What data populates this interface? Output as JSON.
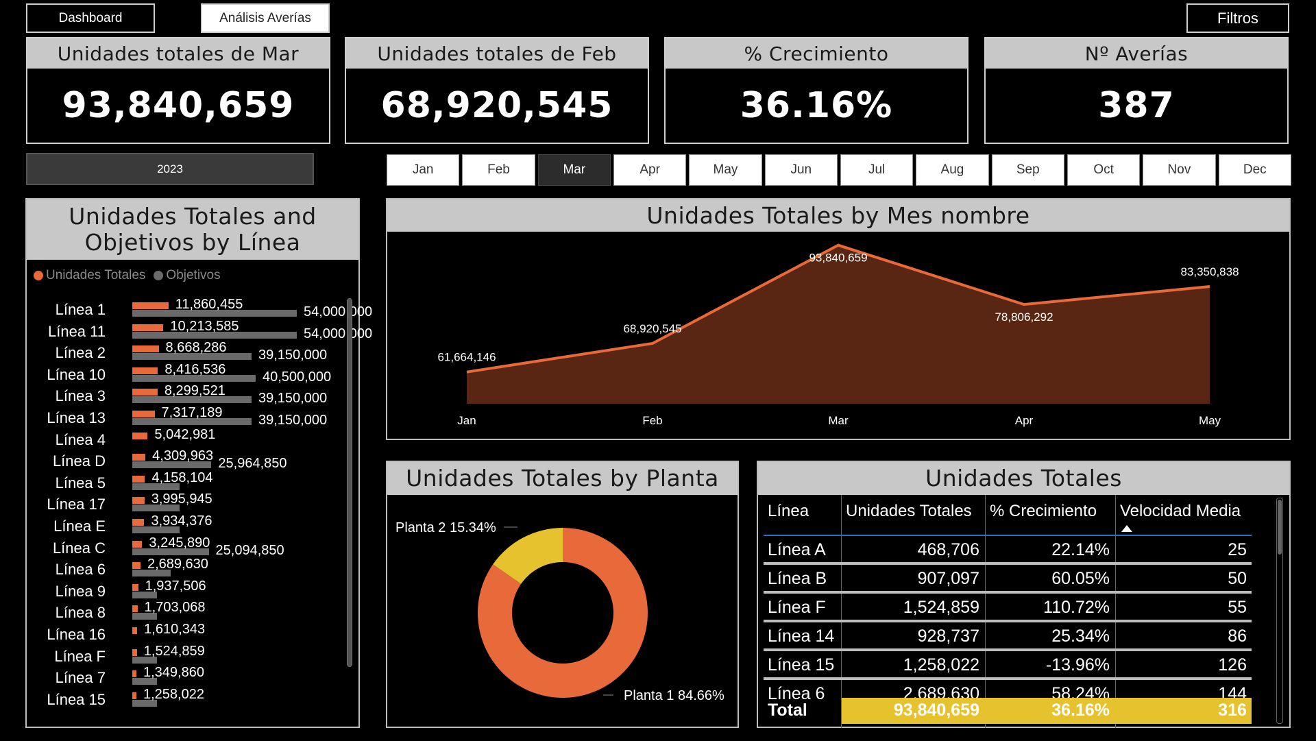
{
  "nav": {
    "dashboard": "Dashboard",
    "averias": "Análisis Averías",
    "filtros": "Filtros"
  },
  "kpis": [
    {
      "label": "Unidades totales de Mar",
      "value": "93,840,659"
    },
    {
      "label": "Unidades totales de Feb",
      "value": "68,920,545"
    },
    {
      "label": "% Crecimiento",
      "value": "36.16%"
    },
    {
      "label": "Nº Averías",
      "value": "387"
    }
  ],
  "year": "2023",
  "months": [
    "Jan",
    "Feb",
    "Mar",
    "Apr",
    "May",
    "Jun",
    "Jul",
    "Aug",
    "Sep",
    "Oct",
    "Nov",
    "Dec"
  ],
  "selected_month": "Mar",
  "colors": {
    "units": "#e8693a",
    "objectives": "#6a6a6a",
    "area_fill": "#5a2614",
    "planta2": "#e6c22e",
    "total_row": "#e6c22e"
  },
  "bar_panel": {
    "title": "Unidades Totales and Objetivos by Línea",
    "legend": [
      "Unidades Totales",
      "Objetivos"
    ]
  },
  "line_panel": {
    "title": "Unidades Totales by Mes nombre"
  },
  "pie_panel": {
    "title": "Unidades Totales by Planta"
  },
  "table_panel": {
    "title": "Unidades Totales",
    "headers": [
      "Línea",
      "Unidades Totales",
      "% Crecimiento",
      "Velocidad Media"
    ],
    "rows": [
      [
        "Línea A",
        "468,706",
        "22.14%",
        "25"
      ],
      [
        "Línea B",
        "907,097",
        "60.05%",
        "50"
      ],
      [
        "Línea F",
        "1,524,859",
        "110.72%",
        "55"
      ],
      [
        "Línea 14",
        "928,737",
        "25.34%",
        "86"
      ],
      [
        "Línea 15",
        "1,258,022",
        "-13.96%",
        "126"
      ],
      [
        "Línea 6",
        "2,689,630",
        "58.24%",
        "144"
      ]
    ],
    "total": [
      "Total",
      "93,840,659",
      "36.16%",
      "316"
    ]
  },
  "chart_data": [
    {
      "type": "bar",
      "title": "Unidades Totales and Objetivos by Línea",
      "categories": [
        "Línea 1",
        "Línea 11",
        "Línea 2",
        "Línea 10",
        "Línea 3",
        "Línea 13",
        "Línea 4",
        "Línea D",
        "Línea 5",
        "Línea 17",
        "Línea E",
        "Línea C",
        "Línea 6",
        "Línea 9",
        "Línea 8",
        "Línea 16",
        "Línea F",
        "Línea 7",
        "Línea 15"
      ],
      "series": [
        {
          "name": "Unidades Totales",
          "values": [
            11860455,
            10213585,
            8668286,
            8416536,
            8299521,
            7317189,
            5042981,
            4309963,
            4158104,
            3995945,
            3934376,
            3245890,
            2689630,
            1937506,
            1703068,
            1610343,
            1524859,
            1349860,
            1258022
          ],
          "labels": [
            "11,860,455",
            "10,213,585",
            "8,668,286",
            "8,416,536",
            "8,299,521",
            "7,317,189",
            "5,042,981",
            "4,309,963",
            "4,158,104",
            "3,995,945",
            "3,934,376",
            "3,245,890",
            "2,689,630",
            "1,937,506",
            "1,703,068",
            "1,610,343",
            "1,524,859",
            "1,349,860",
            "1,258,022"
          ]
        },
        {
          "name": "Objetivos",
          "values": [
            54000000,
            54000000,
            39150000,
            40500000,
            39150000,
            39150000,
            0,
            25964850,
            15500000,
            15500000,
            15500000,
            25094850,
            12600000,
            8000000,
            8000000,
            0,
            8000000,
            8000000,
            8000000
          ],
          "labels": [
            "54,000,000",
            "54,000,000",
            "39,150,000",
            "40,500,000",
            "39,150,000",
            "39,150,000",
            "",
            "25,964,850",
            "",
            "",
            "",
            "25,094,850",
            "",
            "",
            "",
            "",
            "",
            "",
            ""
          ]
        }
      ],
      "legend": "top-left"
    },
    {
      "type": "area",
      "title": "Unidades Totales by Mes nombre",
      "categories": [
        "Jan",
        "Feb",
        "Mar",
        "Apr",
        "May"
      ],
      "values": [
        61664146,
        68920545,
        93840659,
        78806292,
        83350838
      ],
      "labels": [
        "61,664,146",
        "68,920,545",
        "93,840,659",
        "78,806,292",
        "83,350,838"
      ]
    },
    {
      "type": "pie",
      "title": "Unidades Totales by Planta",
      "slices": [
        {
          "name": "Planta 1",
          "value": 84.66,
          "label": "Planta 1 84.66%",
          "color": "#e8693a"
        },
        {
          "name": "Planta 2",
          "value": 15.34,
          "label": "Planta 2 15.34%",
          "color": "#e6c22e"
        }
      ]
    }
  ]
}
